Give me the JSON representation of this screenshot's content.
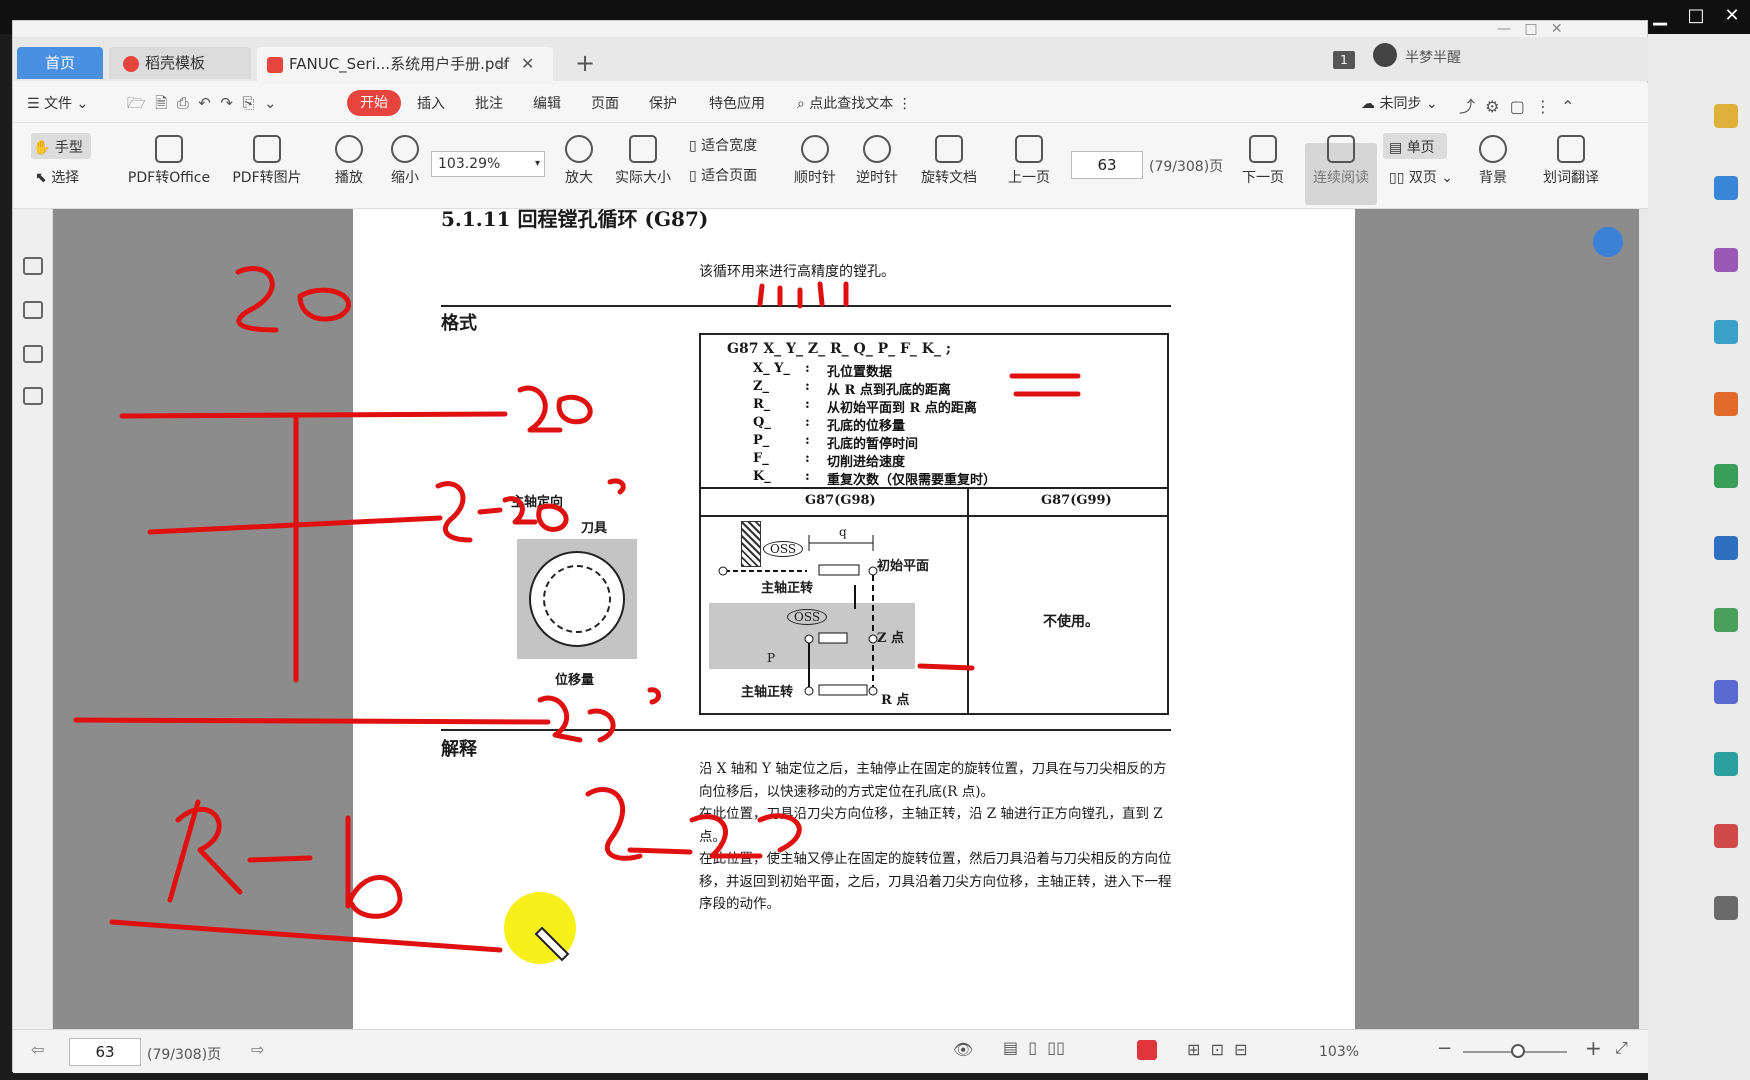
{
  "tabs": {
    "home": "首页",
    "template": "稻壳模板",
    "file": "FANUC_Seri...系统用户手册.pdf"
  },
  "account": {
    "page_badge": "1",
    "user": "半梦半醒"
  },
  "menu": {
    "file": "文件",
    "start": "开始",
    "insert": "插入",
    "annotate": "批注",
    "edit": "编辑",
    "page": "页面",
    "protect": "保护",
    "special": "特色应用",
    "search": "点此查找文本",
    "sync": "未同步"
  },
  "ribbon": {
    "hand": "手型",
    "select": "选择",
    "pdf_office": "PDF转Office",
    "pdf_image": "PDF转图片",
    "play": "播放",
    "zoom_out": "缩小",
    "zoom_value": "103.29%",
    "zoom_in": "放大",
    "actual_size": "实际大小",
    "fit_width": "适合宽度",
    "fit_page": "适合页面",
    "clockwise": "顺时针",
    "counterclockwise": "逆时针",
    "rotate_doc": "旋转文档",
    "prev_page": "上一页",
    "page_number": "63",
    "page_of": "(79/308)页",
    "next_page": "下一页",
    "continuous": "连续阅读",
    "single": "单页",
    "double": "双页",
    "background": "背景",
    "translate": "划词翻译"
  },
  "doc": {
    "section_title": "5.1.11    回程镗孔循环 (G87)",
    "intro": "该循环用来进行高精度的镗孔。",
    "format_heading": "格式",
    "syntax": "G87 X_ Y_ Z_ R_ Q_ P_ F_ K_ ;",
    "params": [
      {
        "code": "X_ Y_",
        "desc": "孔位置数据"
      },
      {
        "code": "Z_",
        "desc": "从 R 点到孔底的距离"
      },
      {
        "code": "R_",
        "desc": "从初始平面到 R 点的距离"
      },
      {
        "code": "Q_",
        "desc": "孔底的位移量"
      },
      {
        "code": "P_",
        "desc": "孔底的暂停时间"
      },
      {
        "code": "F_",
        "desc": "切削进给速度"
      },
      {
        "code": "K_",
        "desc": "重复次数（仅限需要重复时）"
      }
    ],
    "col_g98": "G87(G98)",
    "col_g99": "G87(G99)",
    "not_used": "不使用。",
    "diagram": {
      "spindle_orient": "主轴定向",
      "tool": "刀具",
      "shift": "位移量",
      "oss": "OSS",
      "q": "q",
      "initial_plane": "初始平面",
      "spindle_cw": "主轴正转",
      "z_point": "Z 点",
      "r_point": "R 点",
      "p": "P"
    },
    "explain_heading": "解释",
    "explain_lines": [
      "沿 X 轴和 Y 轴定位之后，主轴停止在固定的旋转位置，刀具在与刀尖相反的方",
      "向位移后，以快速移动的方式定位在孔底(R 点)。",
      "在此位置，刀具沿刀尖方向位移，主轴正转，沿 Z 轴进行正方向镗孔，直到 Z",
      "点。",
      "在此位置，使主轴又停止在固定的旋转位置，然后刀具沿着与刀尖相反的方向位",
      "移，并返回到初始平面，之后，刀具沿着刀尖方向位移，主轴正转，进入下一程",
      "序段的动作。"
    ]
  },
  "status": {
    "page_number": "63",
    "page_of": "(79/308)页",
    "zoom": "103%"
  },
  "colors": {
    "accent": "#e6443d",
    "home_tab": "#4a90e2",
    "ink": "#e01010"
  }
}
